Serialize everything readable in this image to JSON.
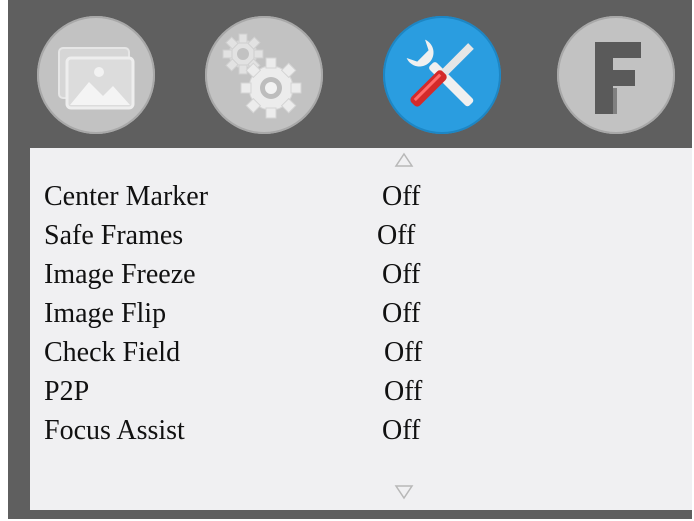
{
  "tabs": [
    {
      "name": "picture",
      "icon": "image-icon",
      "active": false
    },
    {
      "name": "settings",
      "icon": "gears-icon",
      "active": false
    },
    {
      "name": "tools",
      "icon": "tools-icon",
      "active": true
    },
    {
      "name": "function",
      "icon": "function-f-icon",
      "active": false
    }
  ],
  "colors": {
    "frame": "#5f5f5f",
    "panel": "#f0f0f2",
    "tab_inactive": "#c2c2c2",
    "tab_active": "#2a9de0",
    "text": "#111111"
  },
  "menu": {
    "items": [
      {
        "label": "Center Marker",
        "value": "Off"
      },
      {
        "label": "Safe Frames",
        "value": "Off"
      },
      {
        "label": "Image Freeze",
        "value": "Off"
      },
      {
        "label": "Image Flip",
        "value": "Off"
      },
      {
        "label": "Check Field",
        "value": "Off"
      },
      {
        "label": "P2P",
        "value": "Off"
      },
      {
        "label": "Focus Assist",
        "value": "Off"
      }
    ],
    "scroll_up_icon": "arrow-up-icon",
    "scroll_down_icon": "arrow-down-icon"
  }
}
